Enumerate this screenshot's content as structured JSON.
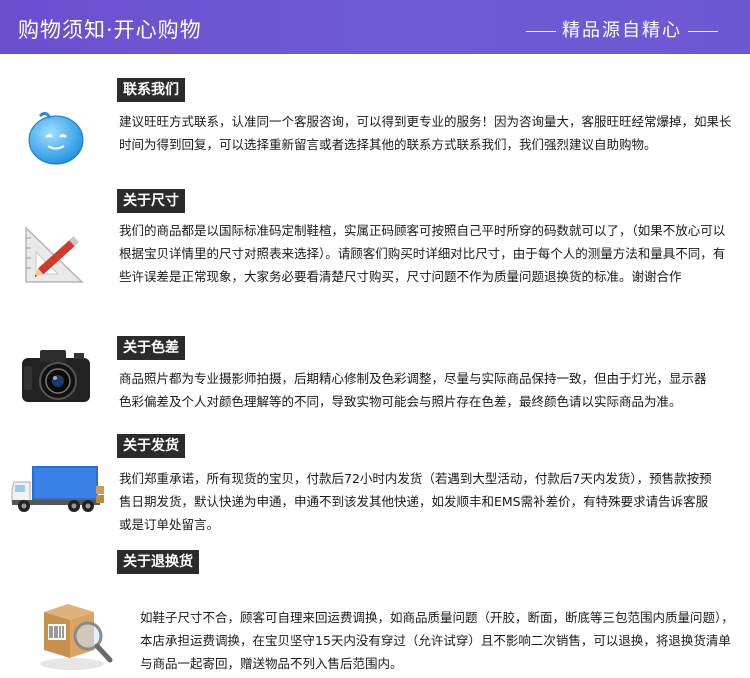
{
  "banner": {
    "title": "购物须知·开心购物",
    "slogan": "精品源自精心"
  },
  "sections": [
    {
      "title": "联系我们",
      "icon": "chat-bubble-icon",
      "body": "建议旺旺方式联系，认准同一个客服咨询，可以得到更专业的服务！因为咨询量大，客服旺旺经常爆掉，如果长时间为得到回复，可以选择重新留言或者选择其他的联系方式联系我们，我们强烈建议自助购物。"
    },
    {
      "title": "关于尺寸",
      "icon": "ruler-pencil-icon",
      "body": "我们的商品都是以国际标准码定制鞋楦，实属正码顾客可按照自己平时所穿的码数就可以了，（如果不放心可以根据宝贝详情里的尺寸对照表来选择）。请顾客们购买时详细对比尺寸，由于每个人的测量方法和量具不同，有些许误差是正常现象，大家务必要看清楚尺寸购买，尺寸问题不作为质量问题退换货的标准。谢谢合作"
    },
    {
      "title": "关于色差",
      "icon": "camera-icon",
      "body": "商品照片都为专业摄影师拍摄，后期精心修制及色彩调整，尽量与实际商品保持一致，但由于灯光，显示器色彩偏差及个人对颜色理解等的不同，导致实物可能会与照片存在色差，最终颜色请以实际商品为准。"
    },
    {
      "title": "关于发货",
      "icon": "delivery-truck-icon",
      "body": "我们郑重承诺，所有现货的宝贝，付款后72小时内发货（若遇到大型活动，付款后7天内发货），预售款按预售日期发货，默认快递为申通，申通不到该发其他快递，如发顺丰和EMS需补差价，有特殊要求请告诉客服或是订单处留言。"
    },
    {
      "title": "关于退换货",
      "icon": "package-magnifier-icon",
      "body": "如鞋子尺寸不合，顾客可自理来回运费调换，如商品质量问题（开胶，断面，断底等三包范围内质量问题），本店承担运费调换，在宝贝坚守15天内没有穿过（允许试穿）且不影响二次销售，可以退换，将退换货清单与商品一起寄回，赠送物品不列入售后范围内。"
    }
  ]
}
